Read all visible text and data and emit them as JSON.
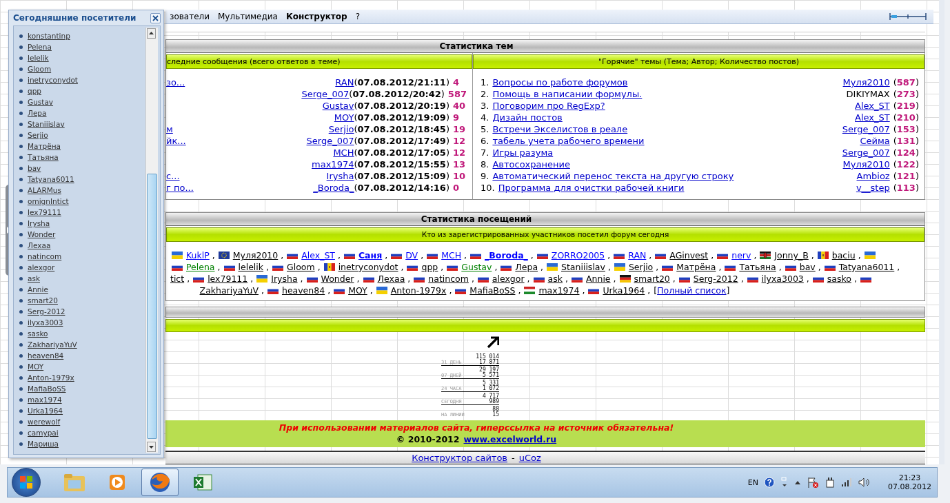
{
  "menu": [
    {
      "label": "зователи",
      "selected": false
    },
    {
      "label": "Мультимедиа",
      "selected": false
    },
    {
      "label": "Конструктор",
      "selected": true
    },
    {
      "label": "?",
      "selected": false
    }
  ],
  "visitors_panel": {
    "title": "Сегодняшние посетители",
    "items": [
      "konstantinp",
      "Pelena",
      "lelelik",
      "Gloom",
      "inetryconydot",
      "qpp",
      "Gustav",
      "Лера",
      "Staniiislav",
      "Serjio",
      "Матрёна",
      "Татьяна",
      "bav",
      "Tatyana6011",
      "ALARMus",
      "omignIntict",
      "lex79111",
      "Irysha",
      "Wonder",
      "Лехаа",
      "natincom",
      "alexgor",
      "ask",
      "Annie",
      "smart20",
      "Serg-2012",
      "ilyxa3003",
      "sasko",
      "ZakhariyaYuV",
      "heaven84",
      "MOY",
      "Anton-1979x",
      "MafiaBoSS",
      "max1974",
      "Urka1964",
      "werewolf",
      "camypai",
      "Мариша"
    ]
  },
  "topic_stats": {
    "title": "Статистика тем",
    "latest": {
      "header": "следние сообщения (всего ответов в теме)",
      "rows": [
        {
          "topic": "зо...",
          "author": "RAN",
          "date": "(**07.08.2012/21:11**)",
          "replies": "4"
        },
        {
          "author": "Serge_007",
          "date": "(**07.08.2012/20:42**)",
          "replies": "587"
        },
        {
          "author": "Gustav",
          "date": "(**07.08.2012/20:19**)",
          "replies": "40"
        },
        {
          "author": "MOY",
          "date": "(**07.08.2012/19:09**)",
          "replies": "9"
        },
        {
          "topic": "м",
          "author": "Serjio",
          "date": "(**07.08.2012/18:45**)",
          "replies": "19"
        },
        {
          "topic": "йк...",
          "author": "Serge_007",
          "date": "(**07.08.2012/17:49**)",
          "replies": "12"
        },
        {
          "author": "MCH",
          "date": "(**07.08.2012/17:05**)",
          "replies": "12"
        },
        {
          "author": "max1974",
          "date": "(**07.08.2012/15:55**)",
          "replies": "13"
        },
        {
          "topic": "с...",
          "author": "Irysha",
          "date": "(**07.08.2012/15:09**)",
          "replies": "10"
        },
        {
          "topic": "г по...",
          "author": "_Boroda_",
          "date": "(**07.08.2012/14:16**)",
          "replies": "0"
        }
      ]
    },
    "hot": {
      "header": "\"Горячие\" темы (Тема; Автор; Количество постов)",
      "rows": [
        {
          "number": "1.",
          "title": "Вопросы по работе форумов",
          "author": "Муля2010",
          "linked": true,
          "posts": "(**587**)"
        },
        {
          "number": "2.",
          "title": "Помощь в написании формулы.",
          "author": "DIKIYMAX",
          "linked": false,
          "posts": "(**273**)"
        },
        {
          "number": "3.",
          "title": "Поговорим про RegExp?",
          "author": "Alex_ST",
          "linked": true,
          "posts": "(**219**)"
        },
        {
          "number": "4.",
          "title": "Дизайн постов",
          "author": "Alex_ST",
          "linked": true,
          "posts": "(**210**)"
        },
        {
          "number": "5.",
          "title": "Встречи Экселистов в реале",
          "author": "Serge_007",
          "linked": true,
          "posts": "(**153**)"
        },
        {
          "number": "6.",
          "title": "табель учета рабочего времени",
          "author": "Сейма",
          "linked": true,
          "posts": "(**131**)"
        },
        {
          "number": "7.",
          "title": "Игры разума",
          "author": "Serge_007",
          "linked": true,
          "posts": "(**124**)"
        },
        {
          "number": "8.",
          "title": "Автосохранение",
          "author": "Муля2010",
          "linked": true,
          "posts": "(**122**)"
        },
        {
          "number": "9.",
          "title": "Автоматический перенос текста на другую строку",
          "author": "Ambioz",
          "linked": true,
          "posts": "(**121**)"
        },
        {
          "number": "10.",
          "title": "Программа для очистки рабочей книги",
          "author": "v__step",
          "linked": true,
          "posts": "(**113**)"
        }
      ]
    }
  },
  "visit_stats": {
    "title": "Статистика посещений",
    "subtitle": "Кто из зарегистрированных участников посетил форум сегодня",
    "separator": ",",
    "lines": [
      [
        {
          "kind": "ua",
          "name": "KuklP",
          "color": "#0000ff"
        },
        {
          "kind": "eu",
          "name": "Муля2010",
          "color": "#000000"
        },
        {
          "kind": "ru",
          "name": "Alex_ST",
          "color": "#0000ff"
        },
        {
          "kind": "ru",
          "name": "Саня",
          "color": "#0000ff",
          "bold": true
        },
        {
          "kind": "ru",
          "name": "DV",
          "color": "#0000ff"
        },
        {
          "kind": "ru",
          "name": "MCH",
          "color": "#0000ff"
        },
        {
          "kind": "ru",
          "name": "_Boroda_",
          "color": "#0000ff",
          "bold": true
        },
        {
          "kind": "ru",
          "name": "ZORRO2005",
          "color": "#0000ff"
        },
        {
          "kind": "ru",
          "name": "RAN",
          "color": "#0000ff"
        },
        {
          "kind": "ru",
          "name": "AGinvest",
          "color": "#000000"
        },
        {
          "kind": "ru",
          "name": "nerv",
          "color": "#0000ff"
        },
        {
          "kind": "ke",
          "name": "Jonny_B",
          "color": "#000000"
        },
        {
          "kind": "md",
          "name": "baciu",
          "color": "#000000"
        },
        {
          "kind": "ua"
        }
      ],
      [
        {
          "kind": "ru",
          "name": "Pelena",
          "color": "#008000"
        },
        {
          "kind": "ru",
          "name": "lelelik",
          "color": "#000000"
        },
        {
          "kind": "ru",
          "name": "Gloom",
          "color": "#000000"
        },
        {
          "kind": "md",
          "name": "inetryconydot",
          "color": "#000000"
        },
        {
          "kind": "ru",
          "name": "qpp",
          "color": "#000000"
        },
        {
          "kind": "ru",
          "name": "Gustav",
          "color": "#008000"
        },
        {
          "kind": "ru",
          "name": "Лера",
          "color": "#000000"
        },
        {
          "kind": "ua",
          "name": "Staniiislav",
          "color": "#000000"
        },
        {
          "kind": "ua",
          "name": "Serjio",
          "color": "#000000"
        },
        {
          "kind": "ru",
          "name": "Матрёна",
          "color": "#000000"
        },
        {
          "kind": "ru",
          "name": "Татьяна",
          "color": "#000000"
        },
        {
          "kind": "ru",
          "name": "bav",
          "color": "#000000"
        },
        {
          "kind": "ru",
          "name": "Tatyana6011",
          "color": "#000000"
        }
      ],
      [
        {
          "kind": "none",
          "name": "tict",
          "color": "#000000"
        },
        {
          "kind": "ru",
          "name": "lex79111",
          "color": "#000000"
        },
        {
          "kind": "ua",
          "name": "Irysha",
          "color": "#000000"
        },
        {
          "kind": "ru",
          "name": "Wonder",
          "color": "#000000"
        },
        {
          "kind": "ru",
          "name": "Лехаа",
          "color": "#000000"
        },
        {
          "kind": "ru",
          "name": "natincom",
          "color": "#000000"
        },
        {
          "kind": "ru",
          "name": "alexgor",
          "color": "#000000"
        },
        {
          "kind": "ru",
          "name": "ask",
          "color": "#000000"
        },
        {
          "kind": "ru",
          "name": "Annie",
          "color": "#000000"
        },
        {
          "kind": "de",
          "name": "smart20",
          "color": "#000000"
        },
        {
          "kind": "ru",
          "name": "Serg-2012",
          "color": "#000000"
        },
        {
          "kind": "ru",
          "name": "ilyxa3003",
          "color": "#000000"
        },
        {
          "kind": "ru",
          "name": "sasko",
          "color": "#000000"
        },
        {
          "kind": "ru"
        }
      ],
      [
        {
          "kind": "none",
          "name": "ZakhariyaYuV",
          "color": "#000000"
        },
        {
          "kind": "ru",
          "name": "heaven84",
          "color": "#000000"
        },
        {
          "kind": "ru",
          "name": "MOY",
          "color": "#000000"
        },
        {
          "kind": "ua",
          "name": "Anton-1979x",
          "color": "#000000"
        },
        {
          "kind": "ru",
          "name": "MafiaBoSS",
          "color": "#000000"
        },
        {
          "kind": "tj",
          "name": "max1974",
          "color": "#000000"
        },
        {
          "kind": "ru",
          "name": "Urka1964",
          "color": "#000000"
        }
      ]
    ],
    "full_list": {
      "open": "[",
      "label": "Полный список",
      "close": "]"
    }
  },
  "counter": {
    "rows": [
      {
        "label": "31 ДЕНЬ",
        "hits": "115 014",
        "hosts": "17 871"
      },
      {
        "label": "07 ДНЕЙ",
        "hits": "29 197",
        "hosts": "5 571"
      },
      {
        "label": "24 ЧАСА",
        "hits": "5 331",
        "hosts": "1 072"
      },
      {
        "label": "СЕГОДНЯ",
        "hits": "4 717",
        "hosts": "989"
      },
      {
        "label": "НА ЛИНИИ",
        "hits": "88",
        "hosts": "15"
      }
    ]
  },
  "footer": {
    "notice": "При использовании материалов сайта, гиперссылка на источник обязательна!",
    "copyright": "© 2010-2012",
    "site": "www.excelworld.ru",
    "links": [
      "Конструктор сайтов",
      "uCoz"
    ],
    "separator": "-"
  },
  "taskbar": {
    "apps": [
      {
        "kind": "folder",
        "selected": false
      },
      {
        "kind": "media",
        "selected": false
      },
      {
        "kind": "browser",
        "selected": true
      },
      {
        "kind": "spreadsheet",
        "selected": false
      }
    ],
    "language": "EN",
    "time": "21:23",
    "date": "07.08.2012"
  }
}
